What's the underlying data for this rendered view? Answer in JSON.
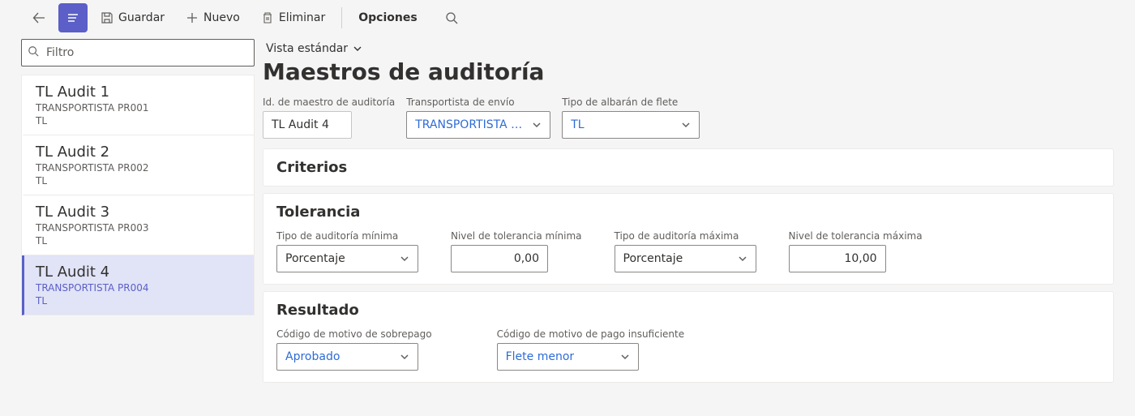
{
  "cmdbar": {
    "guardar": "Guardar",
    "nuevo": "Nuevo",
    "eliminar": "Eliminar",
    "opciones": "Opciones"
  },
  "filter_placeholder": "Filtro",
  "list": [
    {
      "title": "TL Audit 1",
      "carrier": "TRANSPORTISTA PR001",
      "type": "TL"
    },
    {
      "title": "TL Audit 2",
      "carrier": "TRANSPORTISTA PR002",
      "type": "TL"
    },
    {
      "title": "TL Audit 3",
      "carrier": "TRANSPORTISTA PR003",
      "type": "TL"
    },
    {
      "title": "TL Audit 4",
      "carrier": "TRANSPORTISTA PR004",
      "type": "TL"
    }
  ],
  "view_label": "Vista estándar",
  "page_title": "Maestros de auditoría",
  "header_fields": {
    "id_label": "Id. de maestro de auditoría",
    "id_value": "TL Audit 4",
    "carrier_label": "Transportista de envío",
    "carrier_value": "TRANSPORTISTA PR...",
    "billtype_label": "Tipo de albarán de flete",
    "billtype_value": "TL"
  },
  "panels": {
    "criterios": "Criterios",
    "tolerancia": "Tolerancia",
    "resultado": "Resultado"
  },
  "tolerance": {
    "min_type_label": "Tipo de auditoría mínima",
    "min_type_value": "Porcentaje",
    "min_level_label": "Nivel de tolerancia mínima",
    "min_level_value": "0,00",
    "max_type_label": "Tipo de auditoría máxima",
    "max_type_value": "Porcentaje",
    "max_level_label": "Nivel de tolerancia máxima",
    "max_level_value": "10,00"
  },
  "result": {
    "overpay_label": "Código de motivo de sobrepago",
    "overpay_value": "Aprobado",
    "underpay_label": "Código de motivo de pago insuficiente",
    "underpay_value": "Flete menor"
  }
}
